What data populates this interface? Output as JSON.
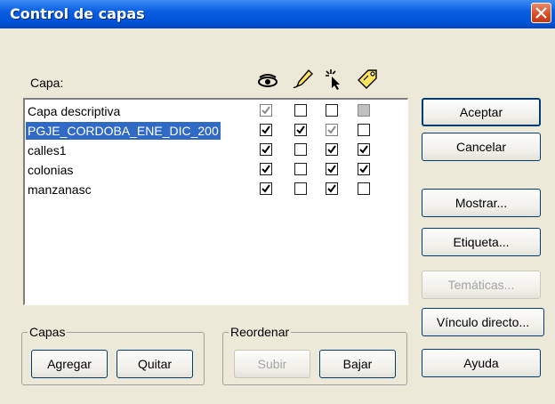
{
  "window": {
    "title": "Control de capas"
  },
  "layer_list": {
    "header_label": "Capa:",
    "column_icons": [
      "eye-icon",
      "pencil-icon",
      "select-cursor-icon",
      "tag-label-icon"
    ],
    "rows": [
      {
        "name": "Capa descriptiva",
        "selected": false,
        "checks": [
          "checked-disabled",
          "unchecked",
          "unchecked",
          "gray"
        ]
      },
      {
        "name": "PGJE_CORDOBA_ENE_DIC_200",
        "selected": true,
        "checks": [
          "checked",
          "checked",
          "checked-disabled",
          "unchecked"
        ]
      },
      {
        "name": "calles1",
        "selected": false,
        "checks": [
          "checked",
          "unchecked",
          "checked",
          "checked"
        ]
      },
      {
        "name": "colonias",
        "selected": false,
        "checks": [
          "checked",
          "unchecked",
          "checked",
          "checked"
        ]
      },
      {
        "name": "manzanasc",
        "selected": false,
        "checks": [
          "checked",
          "unchecked",
          "checked",
          "unchecked"
        ]
      }
    ]
  },
  "buttons": {
    "aceptar": "Aceptar",
    "cancelar": "Cancelar",
    "mostrar": "Mostrar...",
    "etiqueta": "Etiqueta...",
    "tematicas": "Temáticas...",
    "vinculo": "Vínculo directo...",
    "ayuda": "Ayuda"
  },
  "capas_group": {
    "label": "Capas",
    "agregar": "Agregar",
    "quitar": "Quitar"
  },
  "reordenar_group": {
    "label": "Reordenar",
    "subir": "Subir",
    "bajar": "Bajar"
  }
}
